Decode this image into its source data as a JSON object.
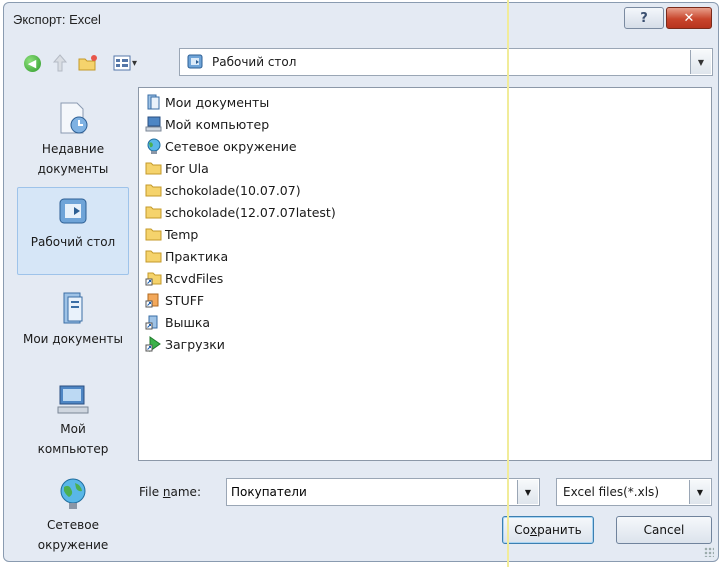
{
  "window": {
    "title": "Экспорт: Excel",
    "help_glyph": "?",
    "close_glyph": "✕"
  },
  "toolbar": {
    "back_glyph": "◀",
    "views_arrow": "▾"
  },
  "location": {
    "value": "Рабочий стол",
    "arrow": "▼"
  },
  "places": [
    {
      "line1": "Недавние",
      "line2": "документы",
      "icon": "recent-documents-icon"
    },
    {
      "line1": "Рабочий стол",
      "line2": "",
      "icon": "desktop-icon",
      "selected": true
    },
    {
      "line1": "Мои документы",
      "line2": "",
      "icon": "my-documents-icon"
    },
    {
      "line1": "Мой",
      "line2": "компьютер",
      "icon": "my-computer-icon"
    },
    {
      "line1": "Сетевое",
      "line2": "окружение",
      "icon": "network-icon"
    }
  ],
  "files": [
    {
      "name": "Мои документы",
      "icon": "my-documents-icon"
    },
    {
      "name": "Мой компьютер",
      "icon": "my-computer-icon"
    },
    {
      "name": "Сетевое окружение",
      "icon": "network-icon"
    },
    {
      "name": "For Ula",
      "icon": "folder-icon"
    },
    {
      "name": "schokolade(10.07.07)",
      "icon": "folder-icon"
    },
    {
      "name": "schokolade(12.07.07latest)",
      "icon": "folder-icon"
    },
    {
      "name": "Temp",
      "icon": "folder-icon"
    },
    {
      "name": "Практика",
      "icon": "folder-icon"
    },
    {
      "name": "RcvdFiles",
      "icon": "shortcut-icon"
    },
    {
      "name": "STUFF",
      "icon": "shortcut-icon"
    },
    {
      "name": "Вышка",
      "icon": "shortcut-icon"
    },
    {
      "name": "Загрузки",
      "icon": "downloads-shortcut-icon"
    }
  ],
  "bottom": {
    "file_name_label_pre": "File ",
    "file_name_label_accel": "n",
    "file_name_label_post": "ame:",
    "file_name_value": "Покупатели",
    "file_type_value": "Excel files(*.xls)",
    "arrow": "▼",
    "save_pre": "Со",
    "save_accel": "х",
    "save_post": "ранить",
    "cancel_label": "Cancel"
  },
  "colors": {
    "dialog_bg": "#e4eaf3",
    "selected_place_bg": "#d6e6f7",
    "close_button": "#c8452c"
  }
}
